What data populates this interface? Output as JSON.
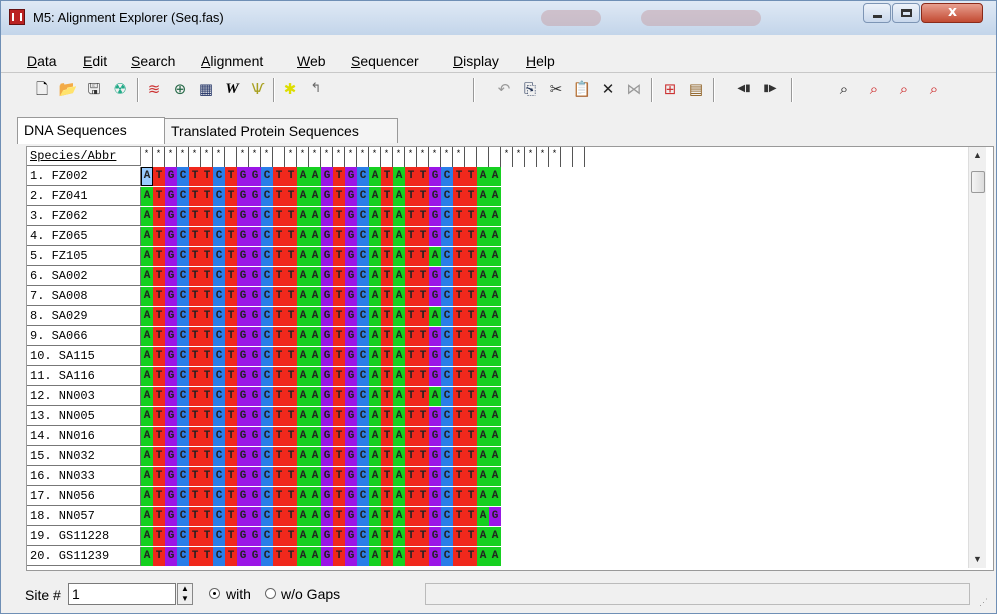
{
  "window": {
    "title": "M5: Alignment Explorer (Seq.fas)"
  },
  "menu": [
    "Data",
    "Edit",
    "Search",
    "Alignment",
    "Web",
    "Sequencer",
    "Display",
    "Help"
  ],
  "toolbar_icons": [
    "new-document-icon",
    "open-folder-icon",
    "save-icon",
    "edit-data-icon",
    "align-by-muscle-icon",
    "network-icon",
    "align-codons-icon",
    "clustalw-icon",
    "genbank-icon",
    "mark-site-icon",
    "translate-icon",
    "undo-icon",
    "copy-icon",
    "cut-icon",
    "paste-icon",
    "delete-icon",
    "delete-gap-icon",
    "add-sequence-icon",
    "add-from-file-icon",
    "move-left-icon",
    "move-right-icon",
    "find-icon",
    "find-previous-icon",
    "find-next-icon",
    "find-motif-icon"
  ],
  "tabs": [
    "DNA Sequences",
    "Translated Protein Sequences"
  ],
  "grid": {
    "header_label": "Species/Abbr",
    "header_marks": [
      "*",
      "*",
      "*",
      "*",
      "*",
      "*",
      "*",
      "",
      "*",
      "*",
      "*",
      "",
      "*",
      "*",
      "*",
      "*",
      "*",
      "*",
      "*",
      "*",
      "*",
      "*",
      "*",
      "*",
      "*",
      "*",
      "*",
      "",
      "",
      "",
      "*",
      "*",
      "*",
      "*",
      "*",
      "",
      ""
    ],
    "sequences": [
      {
        "name": "1.  FZ002",
        "seq": "ATGCTTCTGGCTTAAGTGCATATTGCTTAA"
      },
      {
        "name": "2.  FZ041",
        "seq": "ATGCTTCTGGCTTAAGTGCATATTGCTTAA"
      },
      {
        "name": "3.  FZ062",
        "seq": "ATGCTTCTGGCTTAAGTGCATATTGCTTAA"
      },
      {
        "name": "4.  FZ065",
        "seq": "ATGCTTCTGGCTTAAGTGCATATTGCTTAA"
      },
      {
        "name": "5.  FZ105",
        "seq": "ATGCTTCTGGCTTAAGTGCATATTACTTAA"
      },
      {
        "name": "6.  SA002",
        "seq": "ATGCTTCTGGCTTAAGTGCATATTGCTTAA"
      },
      {
        "name": "7.  SA008",
        "seq": "ATGCTTCTGGCTTAAGTGCATATTGCTTAA"
      },
      {
        "name": "8.  SA029",
        "seq": "ATGCTTCTGGCTTAAGTGCATATTACTTAA"
      },
      {
        "name": "9.  SA066",
        "seq": "ATGCTTCTGGCTTAAGTGCATATTGCTTAA"
      },
      {
        "name": "10. SA115",
        "seq": "ATGCTTCTGGCTTAAGTGCATATTGCTTAA"
      },
      {
        "name": "11. SA116",
        "seq": "ATGCTTCTGGCTTAAGTGCATATTGCTTAA"
      },
      {
        "name": "12. NN003",
        "seq": "ATGCTTCTGGCTTAAGTGCATATTACTTAA"
      },
      {
        "name": "13. NN005",
        "seq": "ATGCTTCTGGCTTAAGTGCATATTGCTTAA"
      },
      {
        "name": "14. NN016",
        "seq": "ATGCTTCTGGCTTAAGTGCATATTGCTTAA"
      },
      {
        "name": "15. NN032",
        "seq": "ATGCTTCTGGCTTAAGTGCATATTGCTTAA"
      },
      {
        "name": "16. NN033",
        "seq": "ATGCTTCTGGCTTAAGTGCATATTGCTTAA"
      },
      {
        "name": "17. NN056",
        "seq": "ATGCTTCTGGCTTAAGTGCATATTGCTTAA"
      },
      {
        "name": "18. NN057",
        "seq": "ATGCTTCTGGCTTAAGTGCATATTGCTTAG"
      },
      {
        "name": "19. GS11228",
        "seq": "ATGCTTCTGGCTTAAGTGCATATTGCTTAA"
      },
      {
        "name": "20. GS11239",
        "seq": "ATGCTTCTGGCTTAAGTGCATATTGCTTAA"
      }
    ],
    "base_colors": {
      "A": "#16d020",
      "T": "#f0281c",
      "G": "#9b16e6",
      "C": "#2a7ee8"
    }
  },
  "status": {
    "site_label": "Site #",
    "site_value": "1",
    "with_gaps_label": "with",
    "without_gaps_label": "w/o Gaps",
    "gaps_mode": "with"
  }
}
